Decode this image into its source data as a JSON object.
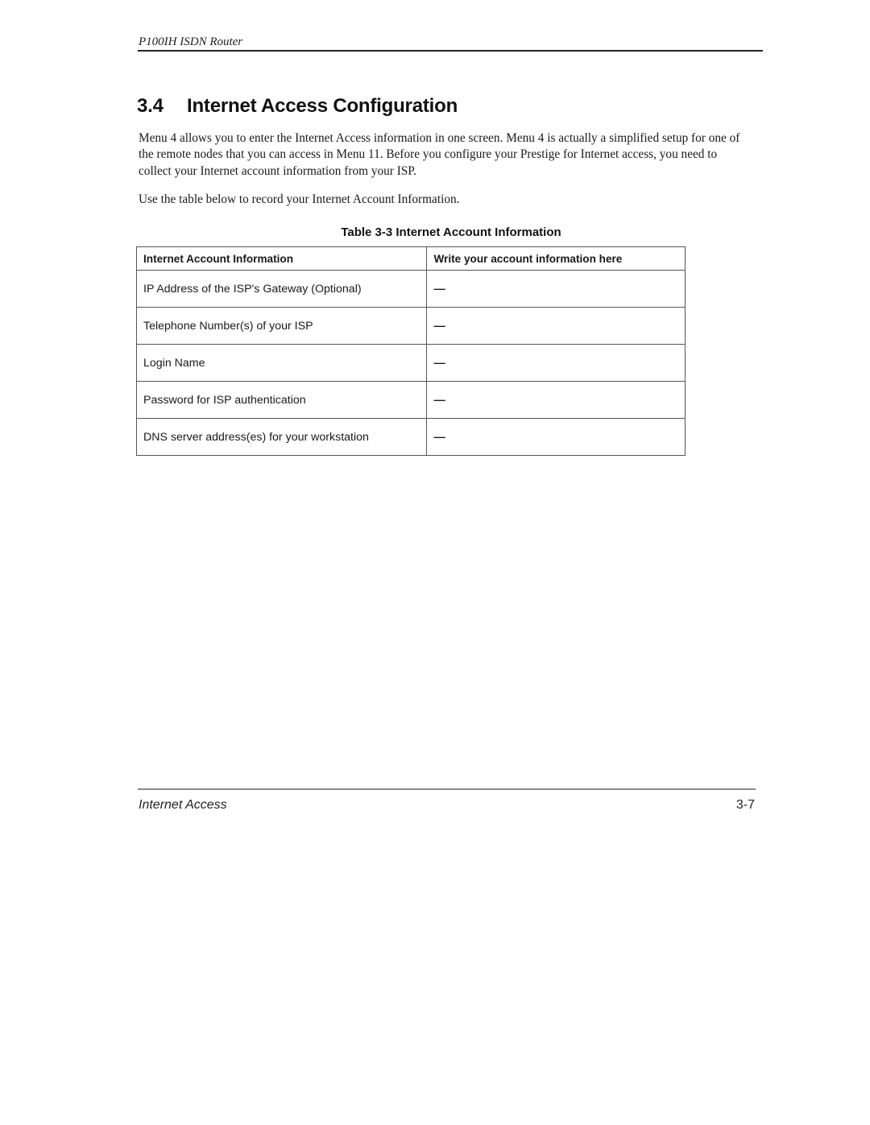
{
  "header": {
    "running_title": "P100IH ISDN Router"
  },
  "section": {
    "number": "3.4",
    "title": "Internet Access Configuration"
  },
  "paragraphs": [
    "Menu 4 allows you to enter the Internet Access information in one screen.  Menu 4 is actually a simplified setup for one of the remote nodes that you can access in Menu 11.  Before you configure your Prestige for Internet access, you need to collect your Internet account information from your ISP.",
    "Use the table below to record your Internet Account Information."
  ],
  "table": {
    "caption": "Table 3-3 Internet Account Information",
    "columns": [
      "Internet Account Information",
      "Write your account information here"
    ],
    "rows": [
      {
        "label": "IP Address of the ISP's Gateway (Optional)",
        "value": "—"
      },
      {
        "label": "Telephone Number(s) of your ISP",
        "value": "—"
      },
      {
        "label": "Login Name",
        "value": "—"
      },
      {
        "label": "Password for ISP authentication",
        "value": "—"
      },
      {
        "label": "DNS server address(es) for your workstation",
        "value": "—"
      }
    ]
  },
  "footer": {
    "chapter": "Internet Access",
    "page_number": "3-7"
  }
}
